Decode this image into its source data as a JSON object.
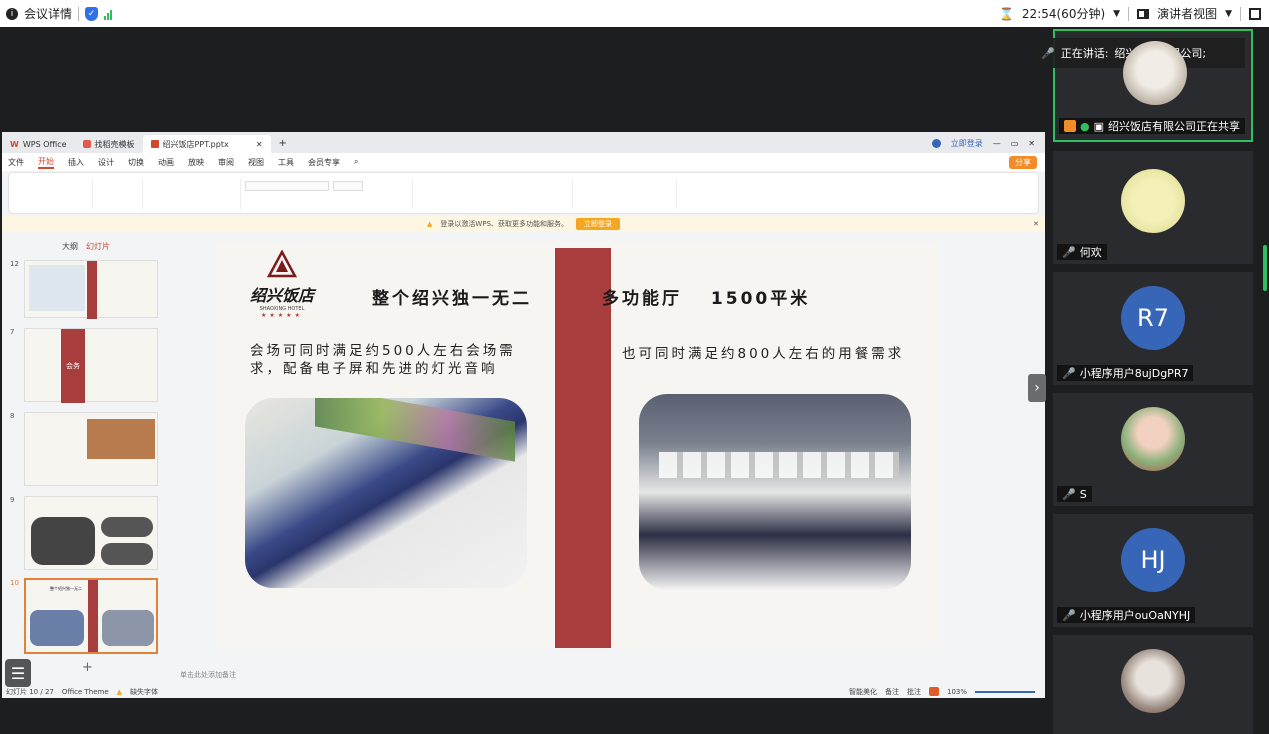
{
  "topbar": {
    "meeting_details": "会议详情",
    "timer": "22:54(60分钟)",
    "view_mode": "演讲者视图"
  },
  "wps": {
    "tabs": [
      "WPS Office",
      "找稻壳模板",
      "绍兴饭店PPT.pptx"
    ],
    "login": "立即登录",
    "share": "分享",
    "menu": [
      "文件",
      "开始",
      "插入",
      "设计",
      "切换",
      "动画",
      "放映",
      "审阅",
      "视图",
      "工具",
      "会员专享"
    ],
    "notice": "登录以激活WPS、获取更多功能和服务。",
    "notice_btn": "立即登录",
    "thumb_tabs": [
      "大纲",
      "幻灯片"
    ],
    "thumb_numbers": [
      "12",
      "7",
      "8",
      "9",
      "10"
    ],
    "thumb7_label": "会务",
    "thumb10_title": "整个绍兴独一无二",
    "add_slide": "+",
    "notes_placeholder": "单击此处添加备注",
    "status": {
      "slide_pos": "幻灯片 10 / 27",
      "theme": "Office Theme",
      "font_missing": "缺失字体",
      "smart": "智能美化",
      "notes": "备注",
      "comments": "批注",
      "zoom": "103%"
    }
  },
  "slide": {
    "logo_name": "绍兴饭店",
    "logo_en": "SHAOXING HOTEL",
    "logo_stars": "★★★★★",
    "title_left": "整个绍兴独一无二",
    "title_right": "多功能厅　 1500平米",
    "text_left": "会场可同时满足约500人左右会场需求，配备电子屏和先进的灯光音响",
    "text_right": "也可同时满足约800人左右的用餐需求"
  },
  "participants": {
    "speaking_prefix": "正在讲话:",
    "speaking_name": "绍兴饭店有限公司;",
    "tiles": [
      {
        "name": "绍兴饭店有限公司正在共享"
      },
      {
        "name": "何欢"
      },
      {
        "name": "小程序用户8ujDgPR7",
        "initials": "R7"
      },
      {
        "name": "S"
      },
      {
        "name": "小程序用户ouOaNYHJ",
        "initials": "HJ"
      }
    ]
  },
  "colors": {
    "accent_red": "#a83d3d",
    "active_green": "#2fbf5e",
    "avatar_blue": "#3766b8"
  }
}
